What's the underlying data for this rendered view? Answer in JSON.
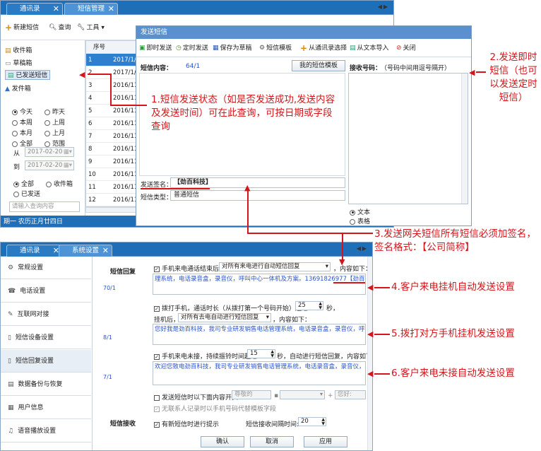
{
  "top": {
    "tabs": [
      "通讯录",
      "短信管理"
    ],
    "toolbar": {
      "new_contact": "新建短信",
      "query": "查询",
      "tools": "工具"
    },
    "sidebar": {
      "folders": [
        "收件箱",
        "草稿箱",
        "已发送短信",
        "发件箱"
      ],
      "date_range": [
        "今天",
        "昨天",
        "本周",
        "上周",
        "本月",
        "上月",
        "全部",
        "范围"
      ],
      "from_label": "从",
      "from_value": "2017-02-20",
      "to_label": "到",
      "to_value": "2017-02-20",
      "scope": [
        "全部",
        "收件箱",
        "已发送"
      ],
      "search_placeholder": "请输入查询内容"
    },
    "table": {
      "header": "序号",
      "rows": [
        {
          "n": "1",
          "d": "2017/1/"
        },
        {
          "n": "2",
          "d": "2017/1/1"
        },
        {
          "n": "3",
          "d": "2016/11/"
        },
        {
          "n": "4",
          "d": "2016/11/"
        },
        {
          "n": "5",
          "d": "2016/11/"
        },
        {
          "n": "6",
          "d": "2016/11/"
        },
        {
          "n": "7",
          "d": "2016/11/"
        },
        {
          "n": "8",
          "d": "2016/11/"
        },
        {
          "n": "9",
          "d": "2016/11/"
        },
        {
          "n": "10",
          "d": "2016/11/"
        },
        {
          "n": "11",
          "d": "2016/11/"
        },
        {
          "n": "12",
          "d": "2016/11/"
        }
      ]
    },
    "status": "期一 农历正月廿四日"
  },
  "dialog": {
    "title": "发送短信",
    "toolbar": [
      "即时发送",
      "定时发送",
      "保存为草稿",
      "短信模板",
      "从通讯录选择",
      "从文本导入",
      "关闭"
    ],
    "content_label": "短信内容：",
    "content_count": "64/1",
    "my_template_button": "我的短信模板",
    "receiver_label": "接收号码：",
    "receiver_hint": "（号码中间用逗号隔开）",
    "sign_label": "发送签名：",
    "sign_value": "【劲百科技】",
    "type_label": "短信类型：",
    "type_value": "普通短信",
    "format_text": "文本",
    "format_table": "表格"
  },
  "bottom": {
    "tabs": [
      "通讯录",
      "系统设置"
    ],
    "nav": [
      "常规设置",
      "电话设置",
      "互联网对接",
      "短信设备设置",
      "短信回复设置",
      "数据备份与恢复",
      "用户信息",
      "语音播放设置"
    ],
    "section_reply": "短信回复",
    "section_receive": "短信接收",
    "row1_check": "手机来电通话结束后，",
    "row1_select": "对所有来电进行自动短信回复",
    "row1_tail": "，内容如下：",
    "count1": "70/1",
    "text1_main": "理系统，电话录音盒，录音仪，呼叫中心一体机及方案。13691826977",
    "text1_sign": "【劲百科技】",
    "row2_check": "拨打手机，通话时长（从拨打第一个号码开始）超过",
    "row2_value": "25",
    "row2_unit": "秒，",
    "row2b_label": "挂机后，",
    "row2b_select": "对所有去电自动进行短信回复",
    "row2b_tail": "，内容如下：",
    "count2": "8/1",
    "text2": "您好我是劲百科技，我司专业研发销售电话管理系统，电话录音盒，录音仪，呼叫中",
    "row3_check": "手机来电未接，持续振铃时间超过",
    "row3_value": "15",
    "row3_tail": "秒，自动进行短信回复，内容如下：",
    "count3": "7/1",
    "text3": "欢迎您致电劲百科技，我司专业研发销售电话管理系统，电话录音盒，录音仪，呼叫",
    "row4_check": "发送短信时以下面内容开头",
    "row4_placeholder": "尊敬的",
    "row4_suffix": "您好:",
    "row5_check": "无联系人记录时以手机号码代替模板字段",
    "recv_check": "有新短信时进行提示",
    "recv_interval_label": "短信接收间隔时间:",
    "recv_interval_value": "20",
    "ok": "确认",
    "cancel": "取消",
    "apply": "应用"
  },
  "annotations": {
    "a1": "1.短信发送状态（如是否发送成功,发送内容及发送时间）可在此查询，可按日期或字段查询",
    "a2": "2.发送即时短信（也可以发送定时短信）",
    "a3": "3.发送网关短信所有短信必须加签名，签名格式：【公司简称】",
    "a4": "4.客户来电挂机自动发送设置",
    "a5": "5.拨打对方手机挂机发送设置",
    "a6": "6.客户来电未接自动发送设置"
  },
  "colors": {
    "annotation": "#d6151b",
    "tabbar": "#1f6fb8",
    "dialog_title": "#5990cd",
    "link_text": "#2b55c8"
  }
}
